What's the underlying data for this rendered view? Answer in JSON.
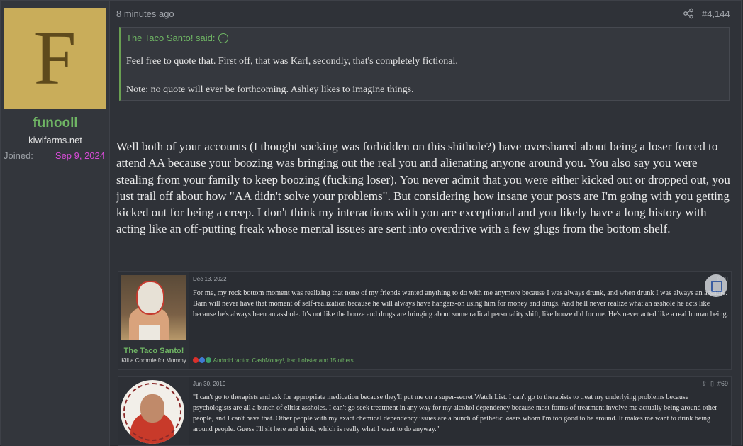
{
  "author": {
    "avatar_letter": "F",
    "name": "funooll",
    "title": "kiwifarms.net",
    "joined_label": "Joined:",
    "joined_value": "Sep 9, 2024"
  },
  "post": {
    "time": "8 minutes ago",
    "number": "#4,144",
    "quote": {
      "header": "The Taco Santo! said:",
      "line1": "Feel free to quote that. First off, that was Karl, secondly, that's completely fictional.",
      "line2": "Note: no quote will ever be forthcoming. Ashley likes to imagine things."
    },
    "body": "Well both of your accounts (I thought socking was forbidden on this shithole?) have overshared about being a loser forced to attend AA because your boozing was bringing out the real you and alienating anyone around you. You also say you were stealing from your family to keep boozing (fucking loser). You never admit that you were either kicked out or dropped out, you just trail off about how \"AA didn't solve your problems\". But considering how insane your posts are I'm going with you getting kicked out for being a creep. I don't think my interactions with you are exceptional and you likely have a long history with acting like an off-putting freak whose mental issues are sent into overdrive with a few glugs from the bottom shelf."
  },
  "embed1": {
    "user": "The Taco Santo!",
    "user_title": "Kill a Commie for Mommy",
    "date": "Dec 13, 2022",
    "text": "For me, my rock bottom moment was realizing that none of my friends wanted anything to do with me anymore because I was always drunk, and when drunk I was always an asshole. Barn will never have that moment of self-realization because he will always have hangers-on using him for money and drugs. And he'll never realize what an asshole he acts like because he's always been an asshole. It's not like the booze and drugs are bringing about some radical personality shift, like booze did for me. He's never acted like a real human being.",
    "reactions": "Android raptor, CashMoney!, Iraq Lobster and 15 others"
  },
  "embed2": {
    "date": "Jun 30, 2019",
    "number": "#69",
    "text": "\"I can't go to therapists and ask for appropriate medication because they'll put me on a super-secret Watch List. I can't go to therapists to treat my underlying problems because psychologists are all a bunch of elitist assholes. I can't go seek treatment in any way for my alcohol dependency because most forms of treatment involve me actually being around other people, and I can't have that. Other people with my exact chemical dependency issues are a bunch of pathetic losers whom I'm too good to be around. It makes me want to drink being around people. Guess I'll sit here and drink, which is really what I want to do anyway.\""
  },
  "colors": {
    "accent_green": "#6fb564",
    "joined_magenta": "#d84bd8",
    "avatar_bg": "#c9ad5a"
  }
}
